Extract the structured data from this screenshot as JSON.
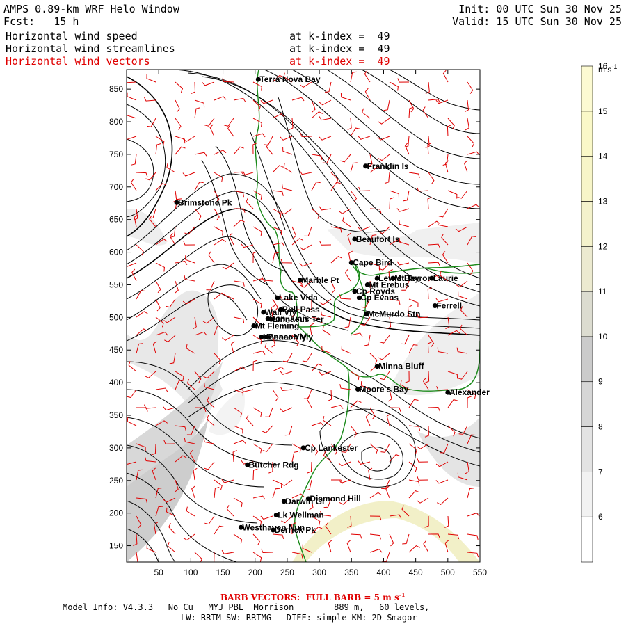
{
  "header": {
    "title": "AMPS 0.89-km WRF Helo Window",
    "forecast": "Fcst:   15 h",
    "init": "Init: 00 UTC Sun 30 Nov 25",
    "valid": "Valid: 15 UTC Sun 30 Nov 25",
    "fields": [
      {
        "name": "Horizontal wind speed",
        "level": "at k-index =  49",
        "color": "#000000"
      },
      {
        "name": "Horizontal wind streamlines",
        "level": "at k-index =  49",
        "color": "#000000"
      },
      {
        "name": "Horizontal wind vectors",
        "level": "at k-index =  49",
        "color": "#e00000"
      }
    ]
  },
  "axes": {
    "x_ticks": [
      "50",
      "100",
      "150",
      "200",
      "250",
      "300",
      "350",
      "400",
      "450",
      "500",
      "550"
    ],
    "y_ticks": [
      "850",
      "800",
      "750",
      "700",
      "650",
      "600",
      "550",
      "500",
      "450",
      "400",
      "350",
      "300",
      "250",
      "200",
      "150"
    ],
    "x_range": [
      0,
      550
    ],
    "y_range": [
      125,
      880
    ]
  },
  "colorbar": {
    "unit": "m s",
    "unit_exp": "-1",
    "ticks": [
      "6",
      "7",
      "8",
      "9",
      "10",
      "11",
      "12",
      "13",
      "14",
      "15",
      "16"
    ],
    "colors": [
      "#ffffff",
      "#f2f2f2",
      "#e3e3e3",
      "#d6d6d6",
      "#cbcbcb",
      "#dcdcd0",
      "#ecead0",
      "#f4f2cc",
      "#f7f5c8",
      "#faf8c8",
      "#fcfad2"
    ]
  },
  "places": [
    {
      "name": "Terra Nova Bay",
      "x": 205,
      "y": 865
    },
    {
      "name": "Franklin Is",
      "x": 372,
      "y": 732
    },
    {
      "name": "Brimstone Pk",
      "x": 78,
      "y": 676
    },
    {
      "name": "Beaufort Is",
      "x": 355,
      "y": 620
    },
    {
      "name": "Cape Bird",
      "x": 350,
      "y": 584
    },
    {
      "name": "Lewis Bay",
      "x": 390,
      "y": 560
    },
    {
      "name": "Mt Terror",
      "x": 415,
      "y": 560
    },
    {
      "name": "Laurie",
      "x": 475,
      "y": 560
    },
    {
      "name": "Marble Pt",
      "x": 270,
      "y": 557
    },
    {
      "name": "Cp Royds",
      "x": 355,
      "y": 540
    },
    {
      "name": "Mt Erebus",
      "x": 375,
      "y": 550
    },
    {
      "name": "Lake Vida",
      "x": 235,
      "y": 530
    },
    {
      "name": "Cp Evans",
      "x": 362,
      "y": 530
    },
    {
      "name": "Ferrell",
      "x": 480,
      "y": 518
    },
    {
      "name": "Wall Vly",
      "x": 213,
      "y": 508
    },
    {
      "name": "Bull Pass",
      "x": 240,
      "y": 512
    },
    {
      "name": "McMurdo Stn",
      "x": 373,
      "y": 505
    },
    {
      "name": "Don Juan",
      "x": 220,
      "y": 498
    },
    {
      "name": "Mt Fleming",
      "x": 198,
      "y": 487
    },
    {
      "name": "Linnaeus Ter",
      "x": 225,
      "y": 497
    },
    {
      "name": "Kennar Vly",
      "x": 210,
      "y": 470
    },
    {
      "name": "Beacon Vly",
      "x": 218,
      "y": 470
    },
    {
      "name": "Minna Bluff",
      "x": 390,
      "y": 425
    },
    {
      "name": "Moore's Bay",
      "x": 360,
      "y": 390
    },
    {
      "name": "Alexander",
      "x": 500,
      "y": 385
    },
    {
      "name": "Cp Lankester",
      "x": 275,
      "y": 300
    },
    {
      "name": "Butcher Rdg",
      "x": 188,
      "y": 274
    },
    {
      "name": "Darwin Gl",
      "x": 245,
      "y": 218
    },
    {
      "name": "Diamond Hill",
      "x": 283,
      "y": 222
    },
    {
      "name": "Lk Wellman",
      "x": 233,
      "y": 197
    },
    {
      "name": "Westhaven Nun",
      "x": 178,
      "y": 178
    },
    {
      "name": "Derrick Pk",
      "x": 228,
      "y": 174
    }
  ],
  "footer": {
    "barb_note": "BARB VECTORS:  FULL BARB = 5 m s",
    "barb_exp": "-1",
    "model_line1": "Model Info: V4.3.3   No Cu   MYJ PBL  Morrison        889 m,   60 levels,",
    "model_line2": "LW: RRTM SW: RRTMG   DIFF: simple KM: 2D Smagor"
  }
}
